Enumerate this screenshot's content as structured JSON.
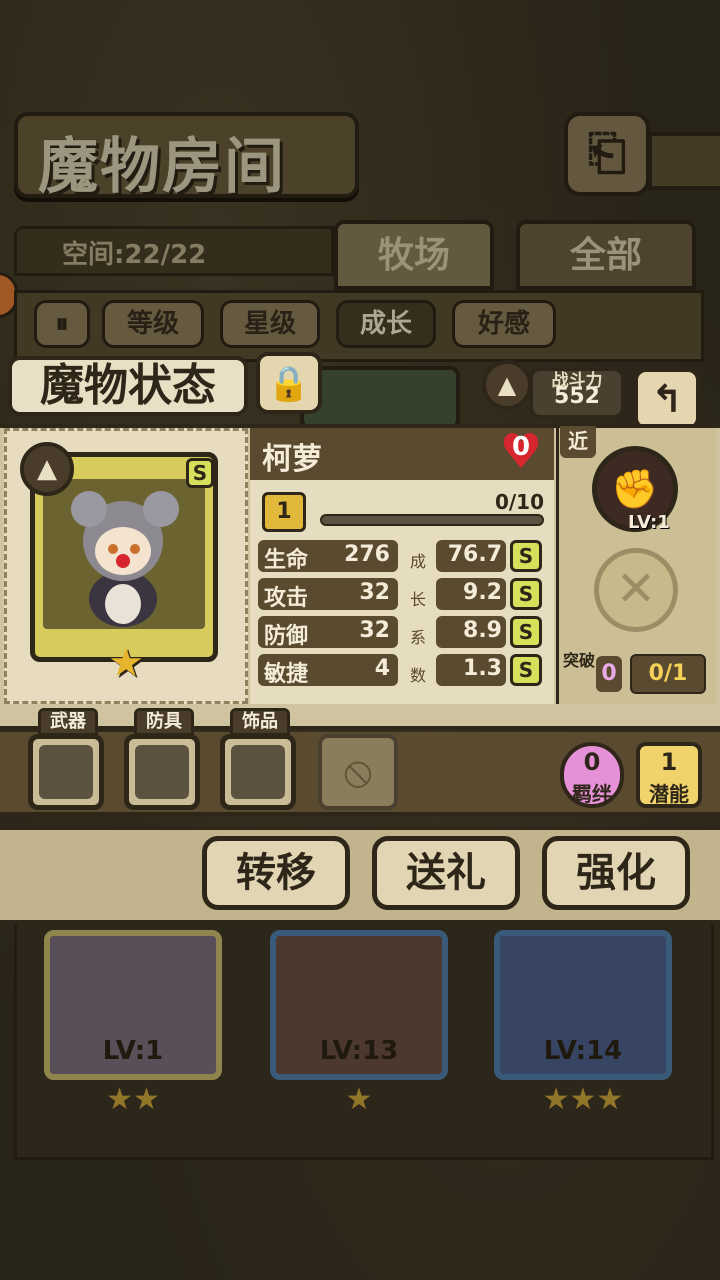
{
  "header": {
    "title": "魔物房间",
    "back_icon": "return-icon"
  },
  "storage": {
    "space_label": "空间:22/22"
  },
  "tabs": [
    {
      "label": "牧场"
    },
    {
      "label": "全部"
    }
  ],
  "filters": [
    {
      "label": "等级"
    },
    {
      "label": "星级"
    },
    {
      "label": "成长"
    },
    {
      "label": "好感"
    }
  ],
  "popup": {
    "title": "魔物状态",
    "power": {
      "label": "战斗力",
      "value": "552"
    },
    "monster": {
      "name": "柯萝",
      "rank": "S",
      "stars": 1,
      "affection": "0",
      "level": "1",
      "exp": "0/10",
      "exp_fraction": 0.0
    },
    "stats": [
      {
        "label": "生命",
        "value": "276",
        "growth": "76.7",
        "grade": "S"
      },
      {
        "label": "攻击",
        "value": "32",
        "growth": "9.2",
        "grade": "S"
      },
      {
        "label": "防御",
        "value": "32",
        "growth": "8.9",
        "grade": "S"
      },
      {
        "label": "敏捷",
        "value": "4",
        "growth": "1.3",
        "grade": "S"
      }
    ],
    "growth_label": [
      "成",
      "长",
      "系",
      "数"
    ],
    "skill": {
      "range": "近",
      "level": "LV:1"
    },
    "breakthrough": {
      "label": "突破",
      "count": "0",
      "progress": "0/1"
    },
    "equipment": {
      "weapon": "武器",
      "armor": "防具",
      "accessory": "饰品"
    },
    "bond": {
      "count": "0",
      "label": "羁绊"
    },
    "potential": {
      "count": "1",
      "label": "潜能"
    },
    "actions": [
      {
        "label": "转移"
      },
      {
        "label": "送礼"
      },
      {
        "label": "强化"
      }
    ]
  },
  "background_cards": [
    {
      "level": "LV:1",
      "stars": "★★"
    },
    {
      "level": "LV:13",
      "stars": "★"
    },
    {
      "level": "LV:14",
      "stars": "★★★"
    }
  ],
  "colors": {
    "heart": "#d8262e",
    "grade": "#d6e05a",
    "bond": "#e690d8",
    "potential": "#f0d36a"
  }
}
